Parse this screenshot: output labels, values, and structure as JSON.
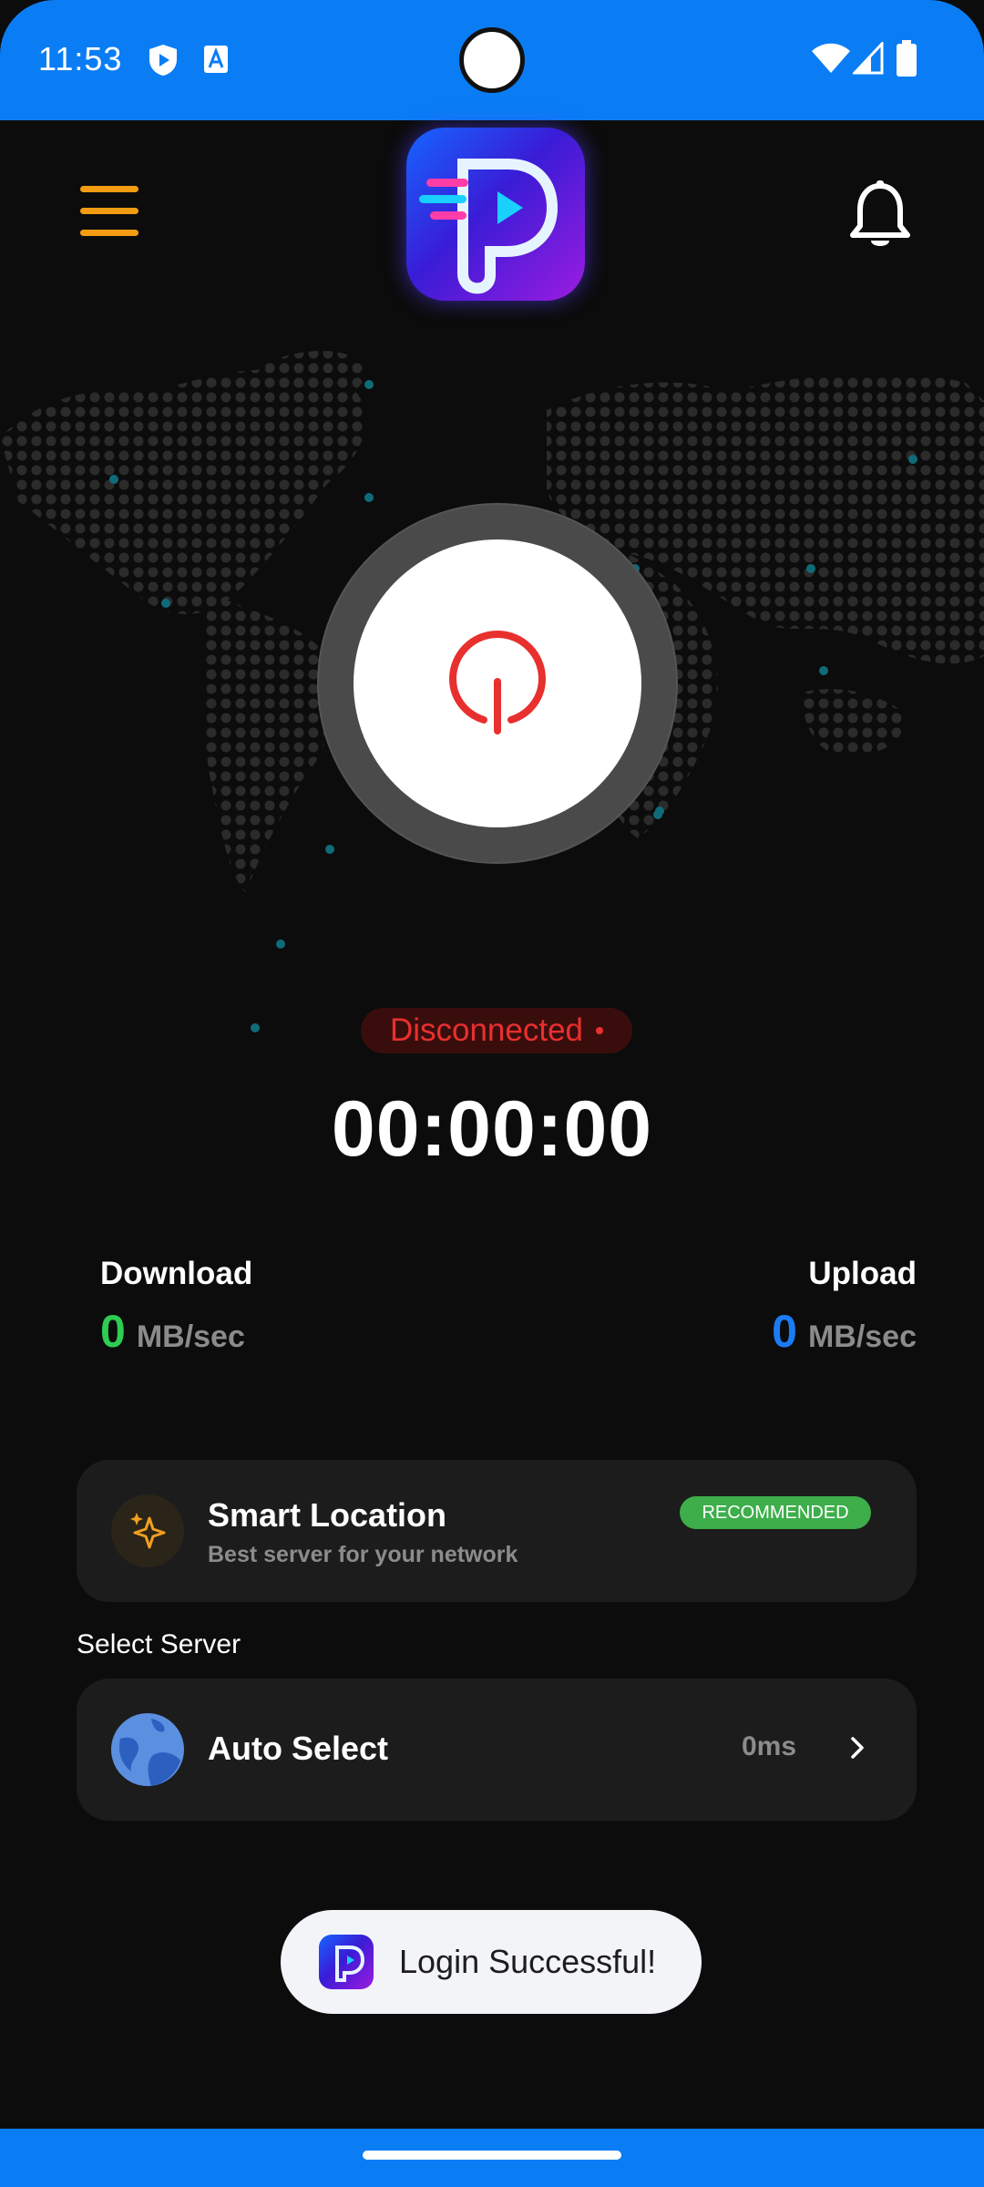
{
  "status_bar": {
    "time": "11:53",
    "icons": [
      "shield-play-icon",
      "font-icon",
      "wifi-icon",
      "signal-icon",
      "battery-icon"
    ]
  },
  "header": {
    "menu_icon": "hamburger-menu-icon",
    "logo": "app-logo-p",
    "bell_icon": "bell-icon"
  },
  "connection": {
    "status": "Disconnected",
    "timer": "00:00:00",
    "power_icon": "power-icon"
  },
  "stats": {
    "download": {
      "label": "Download",
      "value": "0",
      "unit": "MB/sec",
      "color": "#2ecc52"
    },
    "upload": {
      "label": "Upload",
      "value": "0",
      "unit": "MB/sec",
      "color": "#1a7cf5"
    }
  },
  "smart_location": {
    "icon": "sparkles-icon",
    "title": "Smart Location",
    "subtitle": "Best server for your network",
    "badge": "RECOMMENDED"
  },
  "server": {
    "section_label": "Select Server",
    "icon": "globe-icon",
    "name": "Auto Select",
    "ping": "0ms",
    "chevron": "chevron-right-icon"
  },
  "toast": {
    "message": "Login Successful!"
  },
  "colors": {
    "status_bar": "#0a7df5",
    "background": "#0c0c0c",
    "accent_orange": "#f39c12",
    "disconnected_red": "#e8302e",
    "recommended_green": "#3dae4a"
  }
}
